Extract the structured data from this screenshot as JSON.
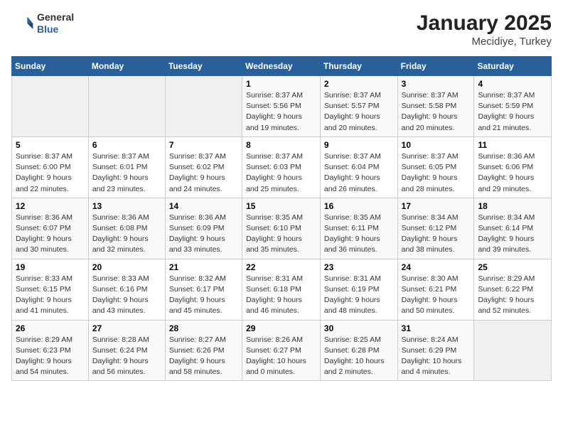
{
  "header": {
    "logo_general": "General",
    "logo_blue": "Blue",
    "title": "January 2025",
    "subtitle": "Mecidiye, Turkey"
  },
  "weekdays": [
    "Sunday",
    "Monday",
    "Tuesday",
    "Wednesday",
    "Thursday",
    "Friday",
    "Saturday"
  ],
  "weeks": [
    [
      {
        "day": "",
        "info": ""
      },
      {
        "day": "",
        "info": ""
      },
      {
        "day": "",
        "info": ""
      },
      {
        "day": "1",
        "info": "Sunrise: 8:37 AM\nSunset: 5:56 PM\nDaylight: 9 hours and 19 minutes."
      },
      {
        "day": "2",
        "info": "Sunrise: 8:37 AM\nSunset: 5:57 PM\nDaylight: 9 hours and 20 minutes."
      },
      {
        "day": "3",
        "info": "Sunrise: 8:37 AM\nSunset: 5:58 PM\nDaylight: 9 hours and 20 minutes."
      },
      {
        "day": "4",
        "info": "Sunrise: 8:37 AM\nSunset: 5:59 PM\nDaylight: 9 hours and 21 minutes."
      }
    ],
    [
      {
        "day": "5",
        "info": "Sunrise: 8:37 AM\nSunset: 6:00 PM\nDaylight: 9 hours and 22 minutes."
      },
      {
        "day": "6",
        "info": "Sunrise: 8:37 AM\nSunset: 6:01 PM\nDaylight: 9 hours and 23 minutes."
      },
      {
        "day": "7",
        "info": "Sunrise: 8:37 AM\nSunset: 6:02 PM\nDaylight: 9 hours and 24 minutes."
      },
      {
        "day": "8",
        "info": "Sunrise: 8:37 AM\nSunset: 6:03 PM\nDaylight: 9 hours and 25 minutes."
      },
      {
        "day": "9",
        "info": "Sunrise: 8:37 AM\nSunset: 6:04 PM\nDaylight: 9 hours and 26 minutes."
      },
      {
        "day": "10",
        "info": "Sunrise: 8:37 AM\nSunset: 6:05 PM\nDaylight: 9 hours and 28 minutes."
      },
      {
        "day": "11",
        "info": "Sunrise: 8:36 AM\nSunset: 6:06 PM\nDaylight: 9 hours and 29 minutes."
      }
    ],
    [
      {
        "day": "12",
        "info": "Sunrise: 8:36 AM\nSunset: 6:07 PM\nDaylight: 9 hours and 30 minutes."
      },
      {
        "day": "13",
        "info": "Sunrise: 8:36 AM\nSunset: 6:08 PM\nDaylight: 9 hours and 32 minutes."
      },
      {
        "day": "14",
        "info": "Sunrise: 8:36 AM\nSunset: 6:09 PM\nDaylight: 9 hours and 33 minutes."
      },
      {
        "day": "15",
        "info": "Sunrise: 8:35 AM\nSunset: 6:10 PM\nDaylight: 9 hours and 35 minutes."
      },
      {
        "day": "16",
        "info": "Sunrise: 8:35 AM\nSunset: 6:11 PM\nDaylight: 9 hours and 36 minutes."
      },
      {
        "day": "17",
        "info": "Sunrise: 8:34 AM\nSunset: 6:12 PM\nDaylight: 9 hours and 38 minutes."
      },
      {
        "day": "18",
        "info": "Sunrise: 8:34 AM\nSunset: 6:14 PM\nDaylight: 9 hours and 39 minutes."
      }
    ],
    [
      {
        "day": "19",
        "info": "Sunrise: 8:33 AM\nSunset: 6:15 PM\nDaylight: 9 hours and 41 minutes."
      },
      {
        "day": "20",
        "info": "Sunrise: 8:33 AM\nSunset: 6:16 PM\nDaylight: 9 hours and 43 minutes."
      },
      {
        "day": "21",
        "info": "Sunrise: 8:32 AM\nSunset: 6:17 PM\nDaylight: 9 hours and 45 minutes."
      },
      {
        "day": "22",
        "info": "Sunrise: 8:31 AM\nSunset: 6:18 PM\nDaylight: 9 hours and 46 minutes."
      },
      {
        "day": "23",
        "info": "Sunrise: 8:31 AM\nSunset: 6:19 PM\nDaylight: 9 hours and 48 minutes."
      },
      {
        "day": "24",
        "info": "Sunrise: 8:30 AM\nSunset: 6:21 PM\nDaylight: 9 hours and 50 minutes."
      },
      {
        "day": "25",
        "info": "Sunrise: 8:29 AM\nSunset: 6:22 PM\nDaylight: 9 hours and 52 minutes."
      }
    ],
    [
      {
        "day": "26",
        "info": "Sunrise: 8:29 AM\nSunset: 6:23 PM\nDaylight: 9 hours and 54 minutes."
      },
      {
        "day": "27",
        "info": "Sunrise: 8:28 AM\nSunset: 6:24 PM\nDaylight: 9 hours and 56 minutes."
      },
      {
        "day": "28",
        "info": "Sunrise: 8:27 AM\nSunset: 6:26 PM\nDaylight: 9 hours and 58 minutes."
      },
      {
        "day": "29",
        "info": "Sunrise: 8:26 AM\nSunset: 6:27 PM\nDaylight: 10 hours and 0 minutes."
      },
      {
        "day": "30",
        "info": "Sunrise: 8:25 AM\nSunset: 6:28 PM\nDaylight: 10 hours and 2 minutes."
      },
      {
        "day": "31",
        "info": "Sunrise: 8:24 AM\nSunset: 6:29 PM\nDaylight: 10 hours and 4 minutes."
      },
      {
        "day": "",
        "info": ""
      }
    ]
  ]
}
